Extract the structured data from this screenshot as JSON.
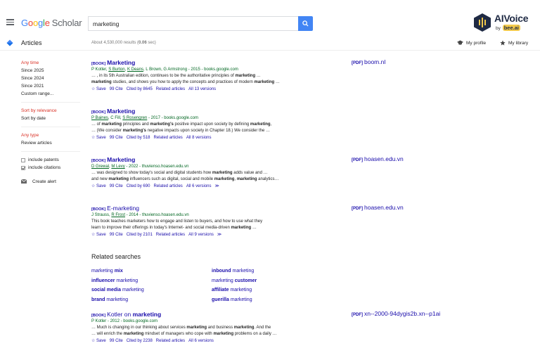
{
  "header": {
    "logo_letters": [
      "G",
      "o",
      "o",
      "g",
      "l",
      "e"
    ],
    "logo_suffix": "Scholar",
    "search_value": "marketing",
    "brand_title": "AIVoice",
    "brand_by": "by",
    "brand_bee": "bee.ai"
  },
  "subbar": {
    "section_label": "Articles",
    "results_prefix": "About 4,530,000 results (",
    "results_time": "0.06",
    "results_suffix": " sec)",
    "my_profile": "My profile",
    "my_library": "My library"
  },
  "sidebar": {
    "time_items": [
      "Any time",
      "Since 2025",
      "Since 2024",
      "Since 2021",
      "Custom range..."
    ],
    "sort_items": [
      "Sort by relevance",
      "Sort by date"
    ],
    "type_items": [
      "Any type",
      "Review articles"
    ],
    "include_patents": "include patents",
    "include_citations": "include citations",
    "create_alert": "Create alert"
  },
  "results": [
    {
      "tag": "[BOOK]",
      "title": "Marketing",
      "authors": [
        "P Kotler, ",
        "S Burton",
        ", ",
        "K Deans",
        ", L Brown, G Armstrong - 2015 - books.google.com"
      ],
      "snippet1": [
        "… , in its 5th Australian edition, continues to be the authoritative principles of ",
        "marketing",
        " …"
      ],
      "snippet2": [
        "marketing",
        " studies, and shows you how to apply the concepts and practices of modern ",
        "marketing",
        " …"
      ],
      "actions": [
        "☆ Save",
        "99 Cite",
        "Cited by 8645",
        "Related articles",
        "All 13 versions"
      ],
      "pdf_tag": "[PDF]",
      "pdf_source": "boom.nl"
    },
    {
      "tag": "[BOOK]",
      "title": "Marketing",
      "authors": [
        "",
        "P Baines",
        ", C Fill, ",
        "S Rosengren",
        " - 2017 - books.google.com"
      ],
      "snippet1": [
        "… of ",
        "marketing",
        " principles and ",
        "marketing's",
        " positive impact upon society by defining ",
        "marketing",
        ","
      ],
      "snippet2": [
        "… (We consider ",
        "marketing's",
        " negative impacts upon society in Chapter 18.) We consider the …"
      ],
      "actions": [
        "☆ Save",
        "99 Cite",
        "Cited by 518",
        "Related articles",
        "All 8 versions"
      ],
      "pdf_tag": "",
      "pdf_source": ""
    },
    {
      "tag": "[BOOK]",
      "title": "Marketing",
      "authors": [
        "",
        "D Grewal",
        ", ",
        "M Levy",
        " - 2022 - thuvienso.hoasen.edu.vn"
      ],
      "snippet1": [
        "… was designed to show today's social and digital students how ",
        "marketing",
        " adds value and …"
      ],
      "snippet2": [
        "and new ",
        "marketing",
        " influencers such as digital, social and mobile ",
        "marketing",
        ", ",
        "marketing",
        " analytics…"
      ],
      "actions": [
        "☆ Save",
        "99 Cite",
        "Cited by 690",
        "Related articles",
        "All 6 versions",
        "≫"
      ],
      "pdf_tag": "[PDF]",
      "pdf_source": "hoasen.edu.vn"
    },
    {
      "tag": "[BOOK]",
      "title": "E-marketing",
      "authors": [
        "J Strauss, ",
        "R Frost",
        " - 2014 - thuvienso.hoasen.edu.vn"
      ],
      "snippet1": [
        "This book teaches marketers how to engage and listen to buyers, and how to use what they",
        "",
        ""
      ],
      "snippet2": [
        "learn to improve their offerings in today's Internet- and social media-driven ",
        "marketing",
        " …"
      ],
      "actions": [
        "☆ Save",
        "99 Cite",
        "Cited by 2101",
        "Related articles",
        "All 9 versions",
        "≫"
      ],
      "pdf_tag": "[PDF]",
      "pdf_source": "hoasen.edu.vn"
    },
    {
      "tag": "[BOOK]",
      "title": "Kotler on ",
      "title_bold": "marketing",
      "authors": [
        "P Kotler - 2012 - books.google.com",
        "",
        "",
        "",
        ""
      ],
      "snippet1": [
        "… Much is changing in our thinking about services ",
        "marketing",
        " and business ",
        "marketing",
        ". And the"
      ],
      "snippet2": [
        "… will enrich the ",
        "marketing",
        " mindset of managers who cope with ",
        "marketing",
        " problems on a daily …"
      ],
      "actions": [
        "☆ Save",
        "99 Cite",
        "Cited by 2238",
        "Related articles",
        "All 6 versions"
      ],
      "pdf_tag": "[PDF]",
      "pdf_source": "xn--2000-94dygis2b.xn--p1ai"
    }
  ],
  "related": {
    "title": "Related searches",
    "items": [
      [
        "marketing ",
        "mix"
      ],
      [
        "",
        "inbound",
        " marketing"
      ],
      [
        "",
        "influencer",
        " marketing"
      ],
      [
        "marketing ",
        "customer"
      ],
      [
        "",
        "social media",
        " marketing"
      ],
      [
        "",
        "affiliate",
        " marketing"
      ],
      [
        "",
        "brand",
        " marketing"
      ],
      [
        "",
        "guerilla",
        " marketing"
      ]
    ]
  },
  "colors": {
    "link": "#1a0dab",
    "author_green": "#006621",
    "active_red": "#d93025",
    "search_blue": "#4285f4"
  }
}
